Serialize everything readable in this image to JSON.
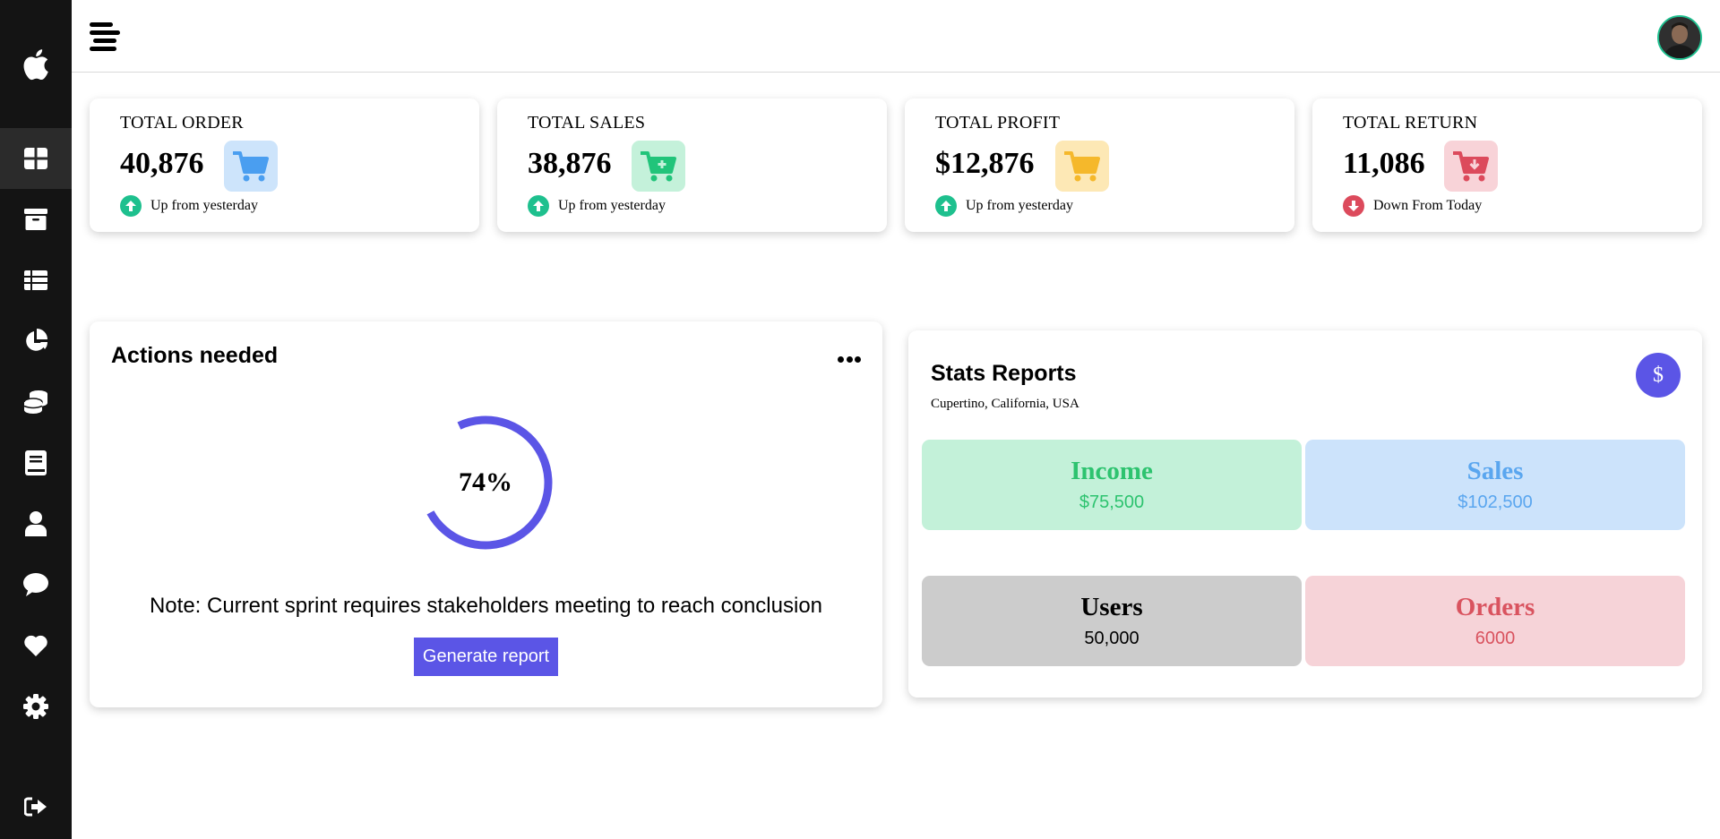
{
  "sidebar": {
    "logo_icon": "apple-icon",
    "items": [
      {
        "name": "dashboard",
        "icon": "grid-icon",
        "active": true
      },
      {
        "name": "archive",
        "icon": "archive-box-icon"
      },
      {
        "name": "table",
        "icon": "table-list-icon"
      },
      {
        "name": "chart",
        "icon": "pie-chart-icon"
      },
      {
        "name": "coins",
        "icon": "coins-icon"
      },
      {
        "name": "book",
        "icon": "book-icon"
      },
      {
        "name": "user",
        "icon": "user-icon"
      },
      {
        "name": "chat",
        "icon": "chat-bubble-icon"
      },
      {
        "name": "favorites",
        "icon": "heart-icon"
      },
      {
        "name": "settings",
        "icon": "gear-icon"
      }
    ],
    "logout_icon": "sign-out-icon"
  },
  "topbar": {
    "menu_icon": "hamburger-menu-icon",
    "avatar": "user-avatar"
  },
  "stats": [
    {
      "title": "TOTAL ORDER",
      "value": "40,876",
      "trend": "Up from yesterday",
      "direction": "up",
      "icon": "shopping-cart-icon",
      "icon_color": "#4a9ef0",
      "icon_bg": "#cde4fb"
    },
    {
      "title": "TOTAL SALES",
      "value": "38,876",
      "trend": "Up from yesterday",
      "direction": "up",
      "icon": "cart-plus-icon",
      "icon_color": "#21c47a",
      "icon_bg": "#c4f1da"
    },
    {
      "title": "TOTAL PROFIT",
      "value": "$12,876",
      "trend": "Up from yesterday",
      "direction": "up",
      "icon": "shopping-cart-icon",
      "icon_color": "#f5b82b",
      "icon_bg": "#fde8b5"
    },
    {
      "title": "TOTAL RETURN",
      "value": "11,086",
      "trend": "Down From Today",
      "direction": "down",
      "icon": "cart-arrow-down-icon",
      "icon_color": "#dc4a5c",
      "icon_bg": "#f8d3d8"
    }
  ],
  "colors": {
    "up": "#1ec08e",
    "down": "#dc4a5c",
    "accent": "#5b55e6",
    "sidebar_bg": "#141414"
  },
  "actions": {
    "title": "Actions needed",
    "progress_label": "74%",
    "progress_value": 0.74,
    "note": "Note: Current sprint requires stakeholders meeting to reach conclusion",
    "button_label": "Generate report"
  },
  "stats_report": {
    "title": "Stats Reports",
    "subtitle": "Cupertino, California, USA",
    "badge": "$",
    "tiles": [
      {
        "label": "Income",
        "value": "$75,500",
        "color": "#2dc36f",
        "bg": "#c3f1d9"
      },
      {
        "label": "Sales",
        "value": "$102,500",
        "color": "#5aa6ef",
        "bg": "#cce3fb"
      },
      {
        "label": "Users",
        "value": "50,000",
        "color": "#000000",
        "bg": "#cccccc"
      },
      {
        "label": "Orders",
        "value": "6000",
        "color": "#d9535f",
        "bg": "#f6d3d8"
      }
    ]
  }
}
